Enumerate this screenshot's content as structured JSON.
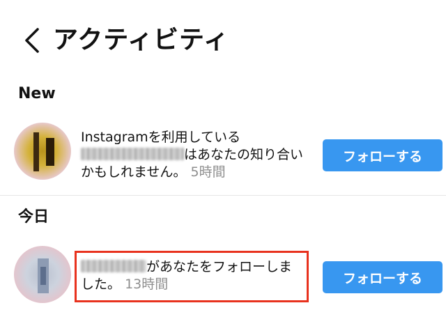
{
  "header": {
    "back_icon": "chevron-left-icon",
    "title": "アクティビティ"
  },
  "sections": {
    "new": {
      "label": "New"
    },
    "today": {
      "label": "今日"
    }
  },
  "notifications": [
    {
      "line1": "Instagramを利用している",
      "text_after_name": "はあなたの知り合い",
      "line3": "かもしれません。",
      "time": "5時間",
      "button_label": "フォローする"
    },
    {
      "text_after_name": "があなたをフォローしま",
      "line2": "した。",
      "time": "13時間",
      "button_label": "フォローする"
    }
  ],
  "colors": {
    "button": "#3897f0",
    "highlight": "#e8321e",
    "time_text": "#8e8e8e"
  }
}
